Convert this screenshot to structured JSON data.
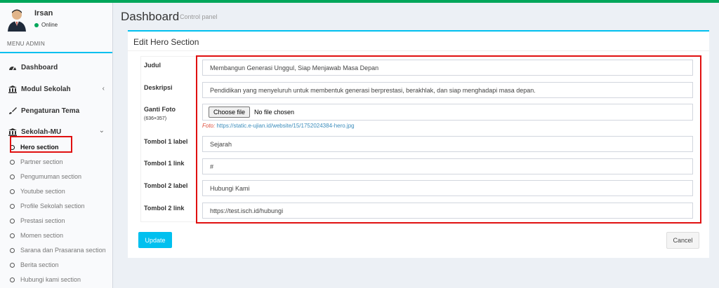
{
  "user": {
    "name": "Irsan",
    "status": "Online"
  },
  "menu": {
    "header": "MENU ADMIN",
    "items": [
      {
        "label": "Dashboard",
        "icon": "dashboard-icon"
      },
      {
        "label": "Modul Sekolah",
        "icon": "bank-icon"
      },
      {
        "label": "Pengaturan Tema",
        "icon": "brush-icon"
      },
      {
        "label": "Sekolah-MU",
        "icon": "bank-icon"
      }
    ],
    "sub_items": [
      "Hero section",
      "Partner section",
      "Pengumuman section",
      "Youtube section",
      "Profile Sekolah section",
      "Prestasi section",
      "Momen section",
      "Sarana dan Prasarana section",
      "Berita section",
      "Hubungi kami section"
    ]
  },
  "page": {
    "title": "Dashboard",
    "subtitle": "Control panel"
  },
  "form": {
    "title": "Edit Hero Section",
    "judul": {
      "label": "Judul",
      "value": "Membangun Generasi Unggul, Siap Menjawab Masa Depan"
    },
    "deskripsi": {
      "label": "Deskripsi",
      "value": "Pendidikan yang menyeluruh untuk membentuk generasi berprestasi, berakhlak, dan siap menghadapi masa depan."
    },
    "foto": {
      "label": "Ganti Foto",
      "size_hint": "(636×357)",
      "button": "Choose file",
      "status": "No file chosen",
      "current_label": "Foto:",
      "current_url": "https://static.e-ujian.id/website/15/1752024384-hero.jpg"
    },
    "tombol1_label": {
      "label": "Tombol 1 label",
      "value": "Sejarah"
    },
    "tombol1_link": {
      "label": "Tombol 1 link",
      "value": "#"
    },
    "tombol2_label": {
      "label": "Tombol 2 label",
      "value": "Hubungi Kami"
    },
    "tombol2_link": {
      "label": "Tombol 2 link",
      "value": "https://test.isch.id/hubungi"
    },
    "update_button": "Update",
    "cancel_button": "Cancel"
  },
  "colors": {
    "accent": "#00c0ef",
    "online": "#00a65a",
    "highlight": "#e01010",
    "link": "#3c8dbc"
  }
}
